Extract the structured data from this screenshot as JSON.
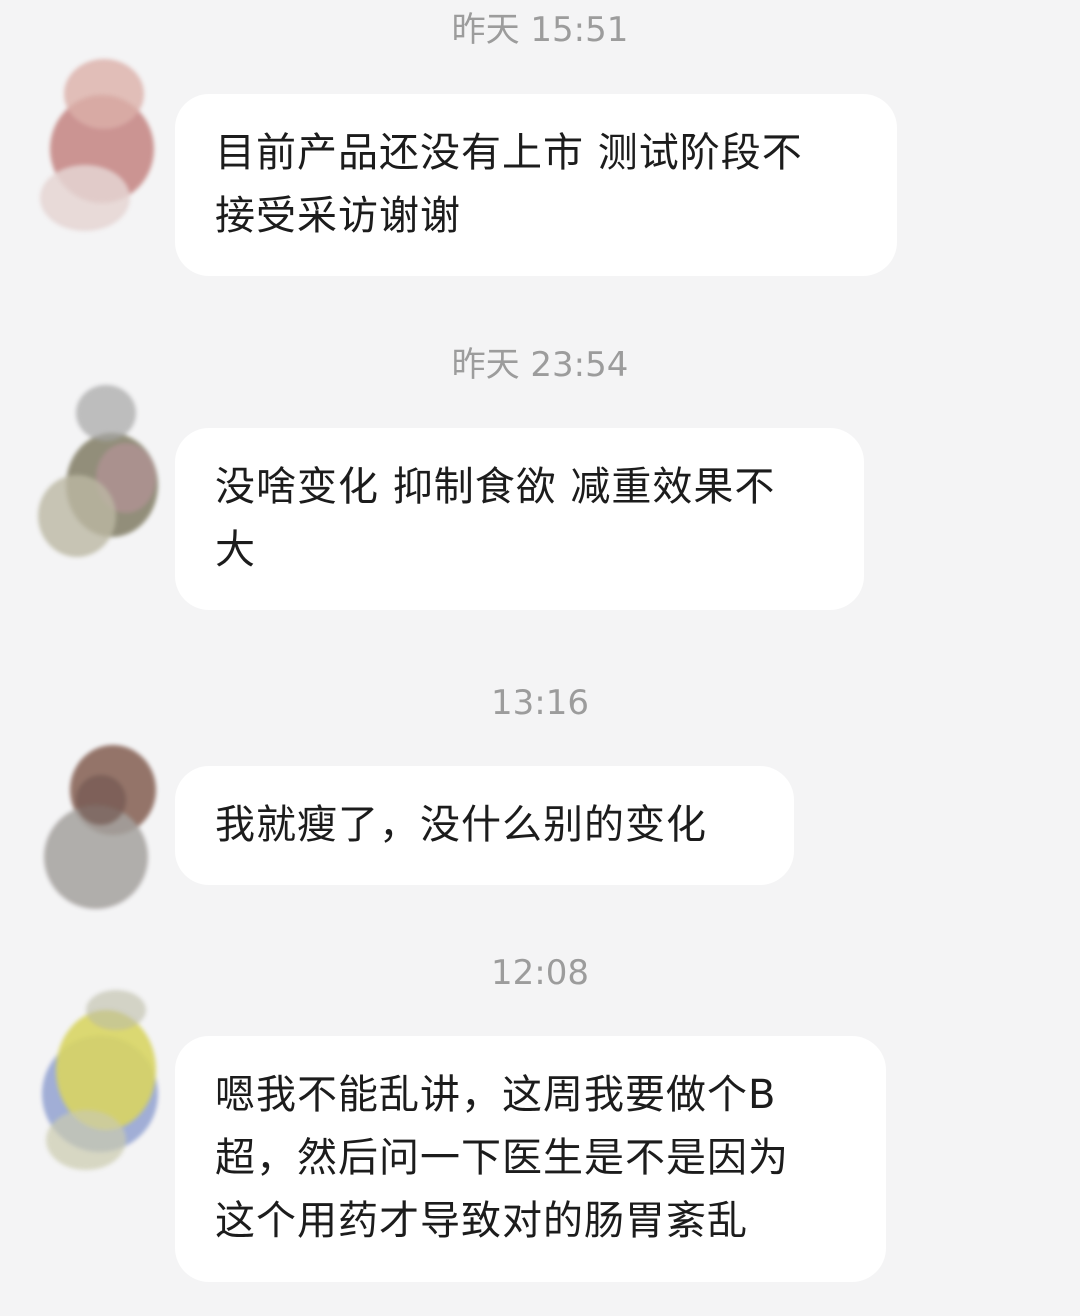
{
  "messages": [
    {
      "time": "昨天 15:51",
      "lines": [
        "目前产品还没有上市 测试阶段不",
        "接受采访谢谢"
      ]
    },
    {
      "time": "昨天 23:54",
      "lines": [
        "没啥变化 抑制食欲 减重效果不",
        "大"
      ]
    },
    {
      "time": "13:16",
      "lines": [
        "我就瘦了，没什么别的变化"
      ]
    },
    {
      "time": "12:08",
      "lines": [
        "嗯我不能乱讲，这周我要做个B",
        "超，然后问一下医生是不是因为",
        "这个用药才导致对的肠胃紊乱"
      ]
    }
  ],
  "colors": {
    "background": "#f4f4f5",
    "bubble": "#ffffff",
    "timestamp_text": "#9c9c9c",
    "message_text": "#1c1c1c"
  },
  "icons": [
    "avatar-icon"
  ]
}
